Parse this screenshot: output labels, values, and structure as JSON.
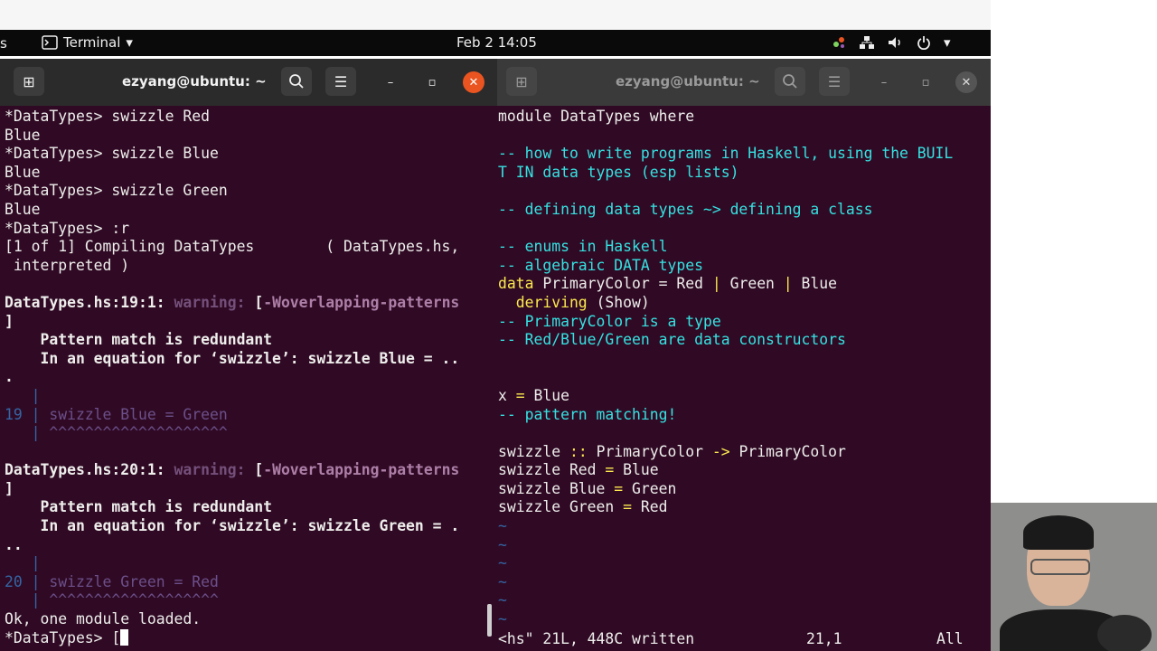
{
  "topbar": {
    "activities": "s",
    "app_label": "Terminal",
    "clock": "Feb 2  14:05"
  },
  "left_window": {
    "title": "ezyang@ubuntu: ~",
    "lines": [
      [
        {
          "t": "*DataTypes> swizzle Red",
          "c": ""
        }
      ],
      [
        {
          "t": "Blue",
          "c": ""
        }
      ],
      [
        {
          "t": "*DataTypes> swizzle Blue",
          "c": ""
        }
      ],
      [
        {
          "t": "Blue",
          "c": ""
        }
      ],
      [
        {
          "t": "*DataTypes> swizzle Green",
          "c": ""
        }
      ],
      [
        {
          "t": "Blue",
          "c": ""
        }
      ],
      [
        {
          "t": "*DataTypes> :r",
          "c": ""
        }
      ],
      [
        {
          "t": "[1 of 1] Compiling DataTypes        ( DataTypes.hs,",
          "c": ""
        }
      ],
      [
        {
          "t": " interpreted )",
          "c": ""
        }
      ],
      [
        {
          "t": "",
          "c": ""
        }
      ],
      [
        {
          "t": "DataTypes.hs:19:1: ",
          "c": "b"
        },
        {
          "t": "warning:",
          "c": "b warn"
        },
        {
          "t": " [",
          "c": "b"
        },
        {
          "t": "-Woverlapping-patterns",
          "c": "b flag"
        }
      ],
      [
        {
          "t": "]",
          "c": "b"
        }
      ],
      [
        {
          "t": "    Pattern match is redundant",
          "c": "b"
        }
      ],
      [
        {
          "t": "    In an equation for ‘swizzle’: swizzle Blue = ..",
          "c": "b"
        }
      ],
      [
        {
          "t": ".",
          "c": "b"
        }
      ],
      [
        {
          "t": "   |",
          "c": "num"
        }
      ],
      [
        {
          "t": "19 | ",
          "c": "num"
        },
        {
          "t": "swizzle Blue = Green",
          "c": "dim"
        }
      ],
      [
        {
          "t": "   | ",
          "c": "num"
        },
        {
          "t": "^^^^^^^^^^^^^^^^^^^^",
          "c": "dim"
        }
      ],
      [
        {
          "t": "",
          "c": ""
        }
      ],
      [
        {
          "t": "DataTypes.hs:20:1: ",
          "c": "b"
        },
        {
          "t": "warning:",
          "c": "b warn"
        },
        {
          "t": " [",
          "c": "b"
        },
        {
          "t": "-Woverlapping-patterns",
          "c": "b flag"
        }
      ],
      [
        {
          "t": "]",
          "c": "b"
        }
      ],
      [
        {
          "t": "    Pattern match is redundant",
          "c": "b"
        }
      ],
      [
        {
          "t": "    In an equation for ‘swizzle’: swizzle Green = .",
          "c": "b"
        }
      ],
      [
        {
          "t": "..",
          "c": "b"
        }
      ],
      [
        {
          "t": "   |",
          "c": "num"
        }
      ],
      [
        {
          "t": "20 | ",
          "c": "num"
        },
        {
          "t": "swizzle Green = Red",
          "c": "dim"
        }
      ],
      [
        {
          "t": "   | ",
          "c": "num"
        },
        {
          "t": "^^^^^^^^^^^^^^^^^^^",
          "c": "dim"
        }
      ],
      [
        {
          "t": "Ok, one module loaded.",
          "c": ""
        }
      ]
    ],
    "prompt": "*DataTypes> ["
  },
  "right_window": {
    "title": "ezyang@ubuntu: ~",
    "lines": [
      [
        {
          "t": "module DataTypes where",
          "c": "pre"
        }
      ],
      [
        {
          "t": "",
          "c": ""
        }
      ],
      [
        {
          "t": "-- how to write programs in Haskell, using the BUIL",
          "c": "cmt"
        }
      ],
      [
        {
          "t": "T IN data types (esp lists)",
          "c": "cmt"
        }
      ],
      [
        {
          "t": "",
          "c": ""
        }
      ],
      [
        {
          "t": "-- defining data types ~> defining a class",
          "c": "cmt"
        }
      ],
      [
        {
          "t": "",
          "c": ""
        }
      ],
      [
        {
          "t": "-- enums in Haskell",
          "c": "cmt"
        }
      ],
      [
        {
          "t": "-- algebraic DATA types",
          "c": "cmt"
        }
      ],
      [
        {
          "t": "data ",
          "c": "kw"
        },
        {
          "t": "PrimaryColor = Red ",
          "c": ""
        },
        {
          "t": "|",
          "c": "kw"
        },
        {
          "t": " Green ",
          "c": ""
        },
        {
          "t": "|",
          "c": "kw"
        },
        {
          "t": " Blue",
          "c": ""
        }
      ],
      [
        {
          "t": "  deriving ",
          "c": "kw"
        },
        {
          "t": "(Show)",
          "c": ""
        }
      ],
      [
        {
          "t": "-- PrimaryColor is a type",
          "c": "cmt"
        }
      ],
      [
        {
          "t": "-- Red/Blue/Green are data constructors",
          "c": "cmt"
        }
      ],
      [
        {
          "t": "",
          "c": ""
        }
      ],
      [
        {
          "t": "",
          "c": ""
        }
      ],
      [
        {
          "t": "x ",
          "c": ""
        },
        {
          "t": "=",
          "c": "kw"
        },
        {
          "t": " Blue",
          "c": ""
        }
      ],
      [
        {
          "t": "-- pattern matching!",
          "c": "cmt"
        }
      ],
      [
        {
          "t": "",
          "c": ""
        }
      ],
      [
        {
          "t": "swizzle ",
          "c": ""
        },
        {
          "t": "::",
          "c": "kw"
        },
        {
          "t": " PrimaryColor ",
          "c": ""
        },
        {
          "t": "->",
          "c": "kw"
        },
        {
          "t": " PrimaryColor",
          "c": ""
        }
      ],
      [
        {
          "t": "swizzle Red ",
          "c": ""
        },
        {
          "t": "=",
          "c": "kw"
        },
        {
          "t": " Blue",
          "c": ""
        }
      ],
      [
        {
          "t": "swizzle Blue ",
          "c": ""
        },
        {
          "t": "=",
          "c": "kw"
        },
        {
          "t": " Green",
          "c": ""
        }
      ],
      [
        {
          "t": "swizzle Green ",
          "c": ""
        },
        {
          "t": "=",
          "c": "kw"
        },
        {
          "t": " Red",
          "c": ""
        }
      ],
      [
        {
          "t": "~",
          "c": "tilde"
        }
      ],
      [
        {
          "t": "~",
          "c": "tilde"
        }
      ],
      [
        {
          "t": "~",
          "c": "tilde"
        }
      ],
      [
        {
          "t": "~",
          "c": "tilde"
        }
      ],
      [
        {
          "t": "~",
          "c": "tilde"
        }
      ],
      [
        {
          "t": "~",
          "c": "tilde"
        }
      ]
    ],
    "status_file": "<hs\" 21L, 448C written",
    "status_pos": "21,1",
    "status_all": "All"
  }
}
